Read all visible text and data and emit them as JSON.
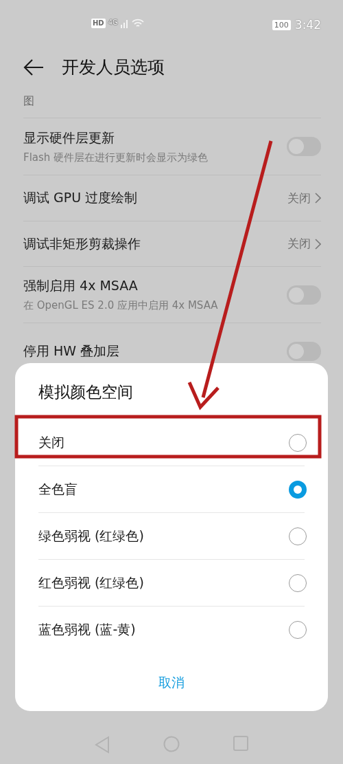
{
  "status_bar": {
    "hd": "HD",
    "network": "4G",
    "battery": "100",
    "time": "3:42"
  },
  "header": {
    "title": "开发人员选项"
  },
  "section_label": "图",
  "settings": [
    {
      "kind": "toggle",
      "title": "显示硬件层更新",
      "subtitle": "Flash 硬件层在进行更新时会显示为绿色",
      "on": false
    },
    {
      "kind": "value",
      "title": "调试 GPU 过度绘制",
      "value": "关闭"
    },
    {
      "kind": "value",
      "title": "调试非矩形剪裁操作",
      "value": "关闭"
    },
    {
      "kind": "toggle",
      "title": "强制启用 4x MSAA",
      "subtitle": "在 OpenGL ES 2.0 应用中启用 4x MSAA",
      "on": false
    },
    {
      "kind": "toggle",
      "title": "停用 HW 叠加层",
      "on": false
    }
  ],
  "dialog": {
    "title": "模拟颜色空间",
    "options": [
      {
        "label": "关闭",
        "selected": false
      },
      {
        "label": "全色盲",
        "selected": true
      },
      {
        "label": "绿色弱视 (红绿色)",
        "selected": false
      },
      {
        "label": "红色弱视 (红绿色)",
        "selected": false
      },
      {
        "label": "蓝色弱视 (蓝-黄)",
        "selected": false
      }
    ],
    "cancel": "取消"
  },
  "annotations": {
    "arrow": true,
    "frame": true
  }
}
